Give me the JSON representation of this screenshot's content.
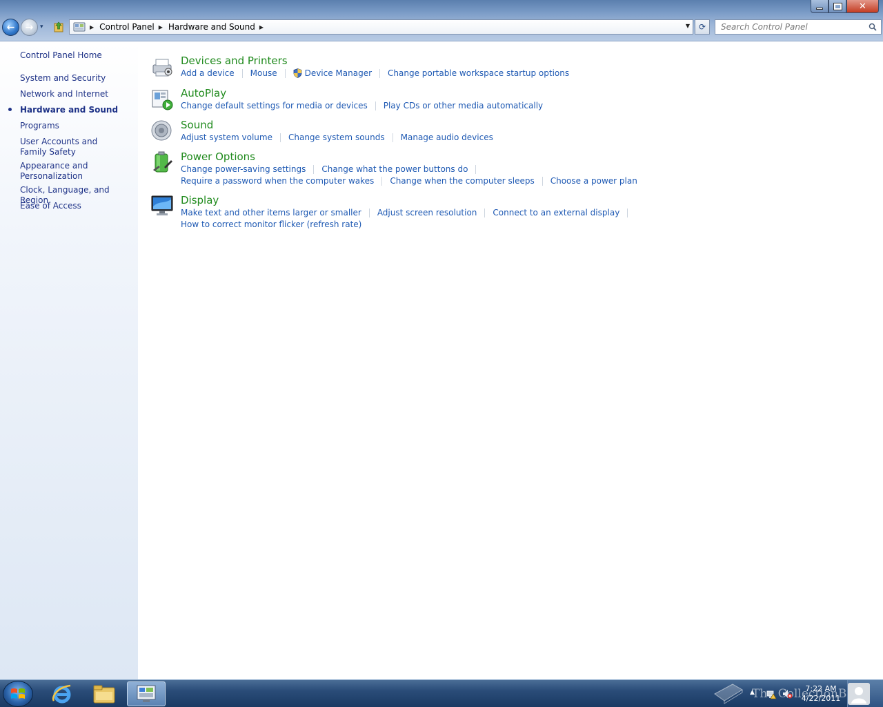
{
  "window": {
    "controls": {
      "minimize": "—",
      "maximize": "□",
      "close": "✕"
    }
  },
  "navigation": {
    "back_glyph": "←",
    "forward_glyph": "→",
    "history_glyph": "▾",
    "refresh_glyph": "⟳"
  },
  "address_bar": {
    "crumbs": [
      "Control Panel",
      "Hardware and Sound"
    ],
    "separator": "▶",
    "dropdown_glyph": "▼"
  },
  "search": {
    "placeholder": "Search Control Panel"
  },
  "sidebar": {
    "home": "Control Panel Home",
    "items": [
      {
        "label": "System and Security"
      },
      {
        "label": "Network and Internet"
      },
      {
        "label": "Hardware and Sound",
        "current": true
      },
      {
        "label": "Programs"
      },
      {
        "label": "User Accounts and Family Safety"
      },
      {
        "label": "Appearance and Personalization"
      },
      {
        "label": "Clock, Language, and Region"
      },
      {
        "label": "Ease of Access"
      }
    ]
  },
  "categories": [
    {
      "title": "Devices and Printers",
      "icon": "printer-icon",
      "rows": [
        [
          "Add a device",
          "Mouse",
          "Device Manager",
          "Change portable workspace startup options"
        ]
      ]
    },
    {
      "title": "AutoPlay",
      "icon": "autoplay-icon",
      "rows": [
        [
          "Change default settings for media or devices",
          "Play CDs or other media automatically"
        ]
      ]
    },
    {
      "title": "Sound",
      "icon": "speaker-icon",
      "rows": [
        [
          "Adjust system volume",
          "Change system sounds",
          "Manage audio devices"
        ]
      ]
    },
    {
      "title": "Power Options",
      "icon": "battery-icon",
      "rows": [
        [
          "Change power-saving settings",
          "Change what the power buttons do"
        ],
        [
          "Require a password when the computer wakes",
          "Change when the computer sleeps",
          "Choose a power plan"
        ]
      ]
    },
    {
      "title": "Display",
      "icon": "monitor-icon",
      "rows": [
        [
          "Make text and other items larger or smaller",
          "Adjust screen resolution",
          "Connect to an external display"
        ],
        [
          "How to correct monitor flicker (refresh rate)"
        ]
      ]
    }
  ],
  "taskbar": {
    "clock_time": "7:22 AM",
    "clock_date": "4/22/2011",
    "tray_arrow": "▲",
    "watermark": "The CollectionBook"
  },
  "colors": {
    "link": "#1e59b3",
    "category_title": "#1f8a1c",
    "sidebar_link": "#1e3287"
  }
}
